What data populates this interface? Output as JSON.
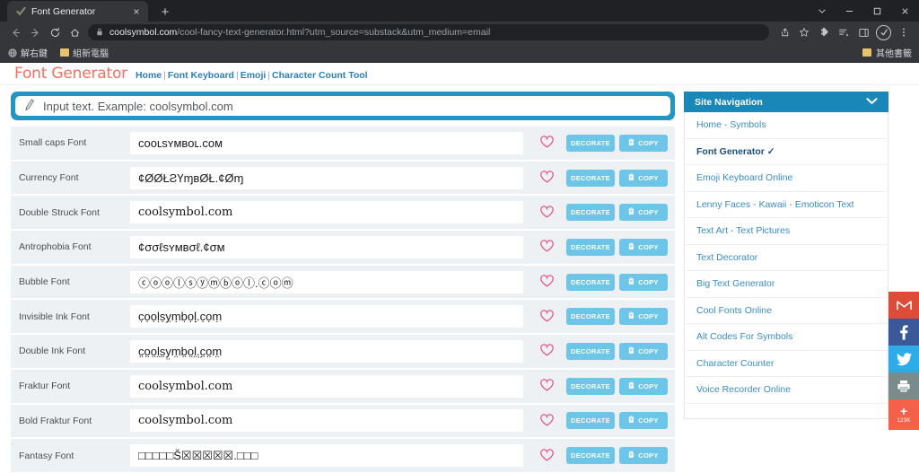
{
  "browser": {
    "tab": {
      "title": "Font Generator",
      "favicon": "checkmark-icon",
      "close": "×"
    },
    "new_tab": "+",
    "window_controls": [
      "chevron-down-icon",
      "minimize-icon",
      "maximize-icon",
      "close-icon"
    ],
    "nav": {
      "back": "←",
      "forward": "→",
      "reload": "↻",
      "home": "⌂"
    },
    "omnibox": {
      "lock": "🔒",
      "host": "coolsymbol.com",
      "path": "/cool-fancy-text-generator.html?utm_source=substack&utm_medium=email",
      "share_icon": "share-icon",
      "star_icon": "star-icon"
    },
    "toolbar_right": [
      "extensions-puzzle-icon",
      "reading-list-icon",
      "side-panel-icon",
      "profile-avatar",
      "chrome-menu-icon"
    ],
    "bookmarks": [
      {
        "label": "解右鍵",
        "icon": "globe-icon"
      },
      {
        "label": "組新電腦",
        "icon": "folder-icon"
      }
    ],
    "bookmarks_right": {
      "label": "其他書籤",
      "icon": "folder-icon"
    }
  },
  "site": {
    "brand": "Font Generator",
    "nav_links": [
      "Home",
      "Font Keyboard",
      "Emoji",
      "Character Count Tool"
    ],
    "nav_separator": "|"
  },
  "search": {
    "placeholder": "Input text. Example: coolsymbol.com",
    "icon": "pencil-icon"
  },
  "buttons": {
    "decorate": "DECORATE",
    "copy": "COPY",
    "copy_icon": "clipboard-icon",
    "favorite_icon": "heart-icon"
  },
  "colors": {
    "brand": "#f1705f",
    "accent_blue": "#2196c4",
    "button_blue": "#6dc5e8",
    "sidebar_header": "#1a87b9",
    "heart_pink": "#e8507e",
    "link_blue": "#3a8dc4"
  },
  "font_rows": [
    {
      "label": "Small caps Font",
      "output": "ᴄᴏᴏʟsʏᴍʙᴏʟ.ᴄᴏᴍ",
      "serif": false
    },
    {
      "label": "Currency Font",
      "output": "¢ØØŁƧҮɱʙØŁ.¢Øɱ",
      "serif": false
    },
    {
      "label": "Double Struck Font",
      "output": "coolsymbol.com",
      "serif": true
    },
    {
      "label": "Antrophobia Font",
      "output": "¢σσℓѕʏмвσℓ.¢σм",
      "serif": false
    },
    {
      "label": "Bubble Font",
      "output": "ⓒⓞⓞⓛⓢⓨⓜⓑⓞⓛ.ⓒⓞⓜ",
      "serif": false
    },
    {
      "label": "Invisible Ink Font",
      "output": "c̣ọọḷṣỵṃḅọḷ.̣c̣ọṃ",
      "serif": false
    },
    {
      "label": "Double Ink Font",
      "output": "c̤o̤o̤l̤s̤y̤m̤b̤o̤l̤.̤c̤o̤m̤",
      "serif": false
    },
    {
      "label": "Fraktur Font",
      "output": "coolsymbol.com",
      "serif": true
    },
    {
      "label": "Bold Fraktur Font",
      "output": "coolsymbol.com",
      "serif": true
    },
    {
      "label": "Fantasy Font",
      "output": "□□□□□Š☒☒☒☒☒.□□□",
      "serif": false
    }
  ],
  "sidebar": {
    "header": "Site Navigation",
    "chevron": "⌄",
    "items": [
      {
        "label": "Home - Symbols",
        "active": false
      },
      {
        "label": "Font Generator ✓",
        "active": true
      },
      {
        "label": "Emoji Keyboard Online",
        "active": false
      },
      {
        "label": "Lenny Faces - Kawaii - Emoticon Text",
        "active": false
      },
      {
        "label": "Text Art - Text Pictures",
        "active": false
      },
      {
        "label": "Text Decorator",
        "active": false
      },
      {
        "label": "Big Text Generator",
        "active": false
      },
      {
        "label": "Cool Fonts Online",
        "active": false
      },
      {
        "label": "Alt Codes For Symbols",
        "active": false
      },
      {
        "label": "Character Counter",
        "active": false
      },
      {
        "label": "Voice Recorder Online",
        "active": false
      }
    ]
  },
  "social": [
    {
      "name": "gmail-share-button",
      "glyph": "M",
      "class": "soc-gmail"
    },
    {
      "name": "facebook-share-button",
      "glyph": "f",
      "class": "soc-fb"
    },
    {
      "name": "twitter-share-button",
      "glyph": "🐦",
      "class": "soc-tw"
    },
    {
      "name": "print-button",
      "glyph": "⎙",
      "class": "soc-print"
    }
  ],
  "share_more": {
    "plus": "+",
    "count": "123K"
  }
}
